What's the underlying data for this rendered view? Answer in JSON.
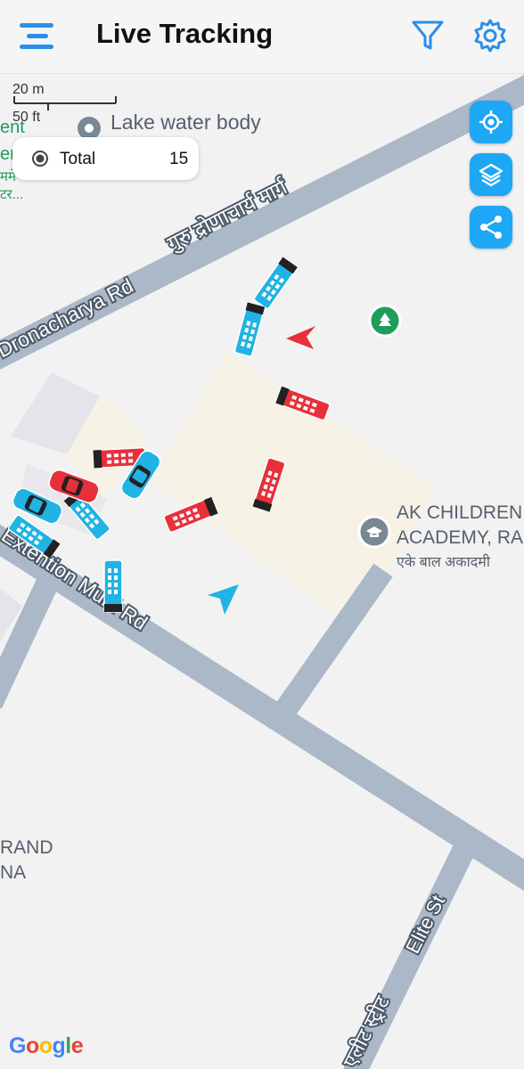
{
  "header": {
    "title": "Live Tracking",
    "menu_icon": "menu-icon",
    "filter_icon": "filter-icon",
    "settings_icon": "gear-icon"
  },
  "scale": {
    "metric": "20 m",
    "imperial": "50 ft"
  },
  "summary": {
    "label": "Total",
    "count": "15"
  },
  "map_controls": [
    {
      "name": "my-location-button",
      "icon": "crosshair-icon"
    },
    {
      "name": "layers-button",
      "icon": "layers-icon"
    },
    {
      "name": "share-button",
      "icon": "share-icon"
    }
  ],
  "map_labels": {
    "poi_lake": "Lake water body",
    "road_hindi": "गुरु द्रोणाचार्य मार्ग",
    "road_dronacharya": "Dronacharya Rd",
    "road_extension": "Extention Murti Rd",
    "school_line1": "AK CHILDREN",
    "school_line2": "ACADEMY, RA",
    "school_hindi": "एके बाल अकादमी",
    "edge_grand_1": "RAND",
    "edge_grand_2": "NA",
    "elite_st": "Elite St",
    "elite_hindi": "एलीट स्ट्रीट",
    "edge_green_1": "ent",
    "edge_green_2": "er.",
    "edge_green_3": "ममे",
    "edge_green_4": "टर..."
  },
  "google_logo": "Google",
  "colors": {
    "accent": "#1ea7f4",
    "menu_blue": "#2b8ee8",
    "bus_red": "#e8303b",
    "bus_cyan": "#21b3e3",
    "road": "#aab8c8",
    "building": "#f7f2e6",
    "park_pin": "#1f9d5a"
  }
}
